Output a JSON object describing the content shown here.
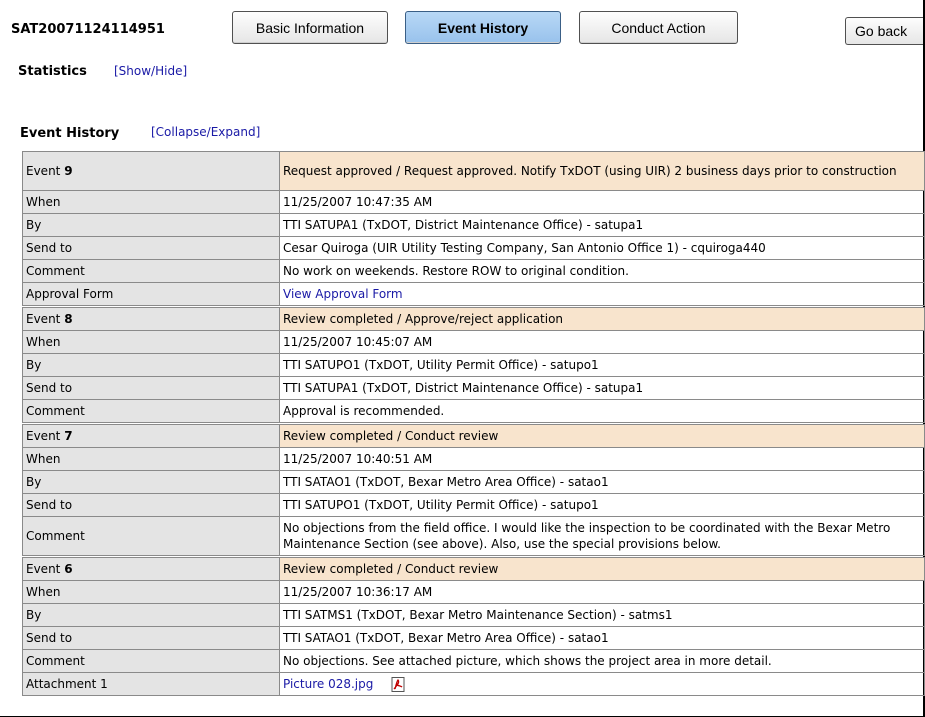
{
  "header": {
    "request_id": "SAT20071124114951",
    "tabs": [
      {
        "label": "Basic Information",
        "active": false
      },
      {
        "label": "Event History",
        "active": true
      },
      {
        "label": "Conduct Action",
        "active": false
      }
    ],
    "go_back_label": "Go back"
  },
  "statistics": {
    "label": "Statistics",
    "toggle": "[Show/Hide]"
  },
  "event_history": {
    "label": "Event History",
    "toggle": "[Collapse/Expand]"
  },
  "field_labels": {
    "event": "Event",
    "when": "When",
    "by": "By",
    "send_to": "Send to",
    "comment": "Comment",
    "approval_form": "Approval Form",
    "attachment_1": "Attachment 1"
  },
  "events": [
    {
      "number": "9",
      "title": "Request approved / Request approved. Notify TxDOT (using UIR) 2 business days prior to construction",
      "when": "11/25/2007 10:47:35 AM",
      "by": "TTI SATUPA1 (TxDOT, District Maintenance Office) - satupa1",
      "send_to": "Cesar Quiroga (UIR Utility Testing Company, San Antonio Office 1) - cquiroga440",
      "comment": "No work on weekends. Restore ROW to original condition.",
      "approval_form_link": "View Approval Form"
    },
    {
      "number": "8",
      "title": "Review completed / Approve/reject application",
      "when": "11/25/2007 10:45:07 AM",
      "by": "TTI SATUPO1 (TxDOT, Utility Permit Office) - satupo1",
      "send_to": "TTI SATUPA1 (TxDOT, District Maintenance Office) - satupa1",
      "comment": "Approval is recommended."
    },
    {
      "number": "7",
      "title": "Review completed / Conduct review",
      "when": "11/25/2007 10:40:51 AM",
      "by": "TTI SATAO1 (TxDOT, Bexar Metro Area Office) - satao1",
      "send_to": "TTI SATUPO1 (TxDOT, Utility Permit Office) - satupo1",
      "comment": "No objections from the field office. I would like the inspection to be coordinated with the Bexar Metro Maintenance Section (see above). Also, use the special provisions below."
    },
    {
      "number": "6",
      "title": "Review completed / Conduct review",
      "when": "11/25/2007 10:36:17 AM",
      "by": "TTI SATMS1 (TxDOT, Bexar Metro Maintenance Section) - satms1",
      "send_to": "TTI SATAO1 (TxDOT, Bexar Metro Area Office) - satao1",
      "comment": "No objections. See attached picture, which shows the project area in more detail.",
      "attachment_1": "Picture 028.jpg",
      "attachment_icon": "pdf-icon"
    }
  ]
}
